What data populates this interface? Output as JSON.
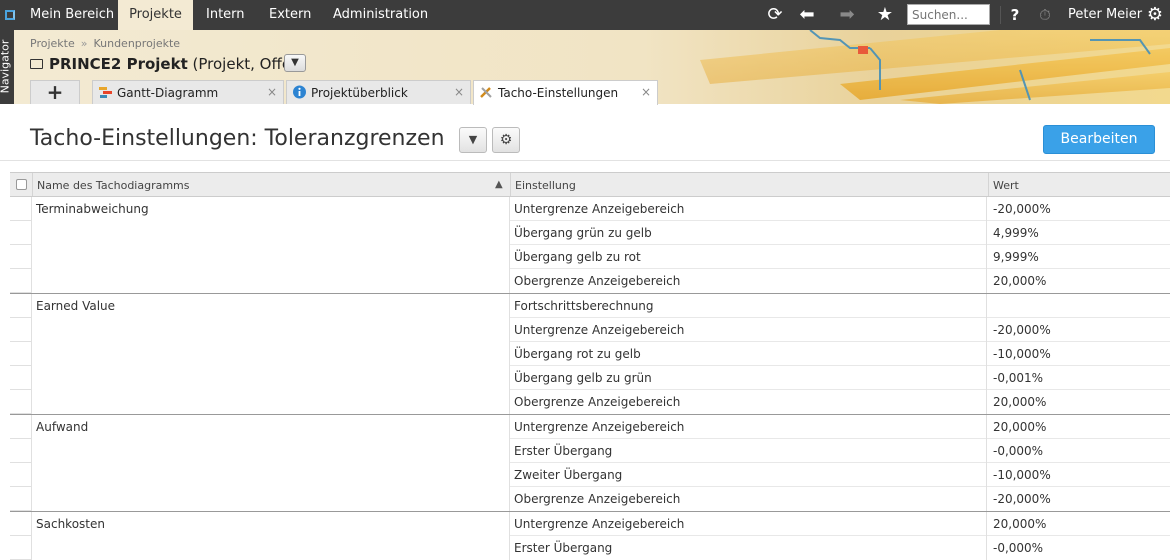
{
  "topnav": {
    "items": [
      "Mein Bereich",
      "Projekte",
      "Intern",
      "Extern",
      "Administration"
    ],
    "search_placeholder": "Suchen...",
    "help": "?",
    "user": "Peter Meier"
  },
  "navigator_label": "Navigator",
  "breadcrumb": {
    "first": "Projekte",
    "separator": "»",
    "second": "Kundenprojekte"
  },
  "project": {
    "name": "PRINCE2 Projekt",
    "meta": "(Projekt, Offen)"
  },
  "tabs": {
    "add": "+",
    "items": [
      {
        "label": "Gantt-Diagramm"
      },
      {
        "label": "Projektüberblick"
      },
      {
        "label": "Tacho-Einstellungen"
      }
    ],
    "close": "×"
  },
  "page": {
    "title": "Tacho-Einstellungen: Toleranzgrenzen",
    "edit_button": "Bearbeiten"
  },
  "table": {
    "columns": [
      "Name des Tachodiagramms",
      "Einstellung",
      "Wert"
    ],
    "groups": [
      {
        "name": "Terminabweichung",
        "rows": [
          {
            "setting": "Untergrenze Anzeigebereich",
            "value": "-20,000%"
          },
          {
            "setting": "Übergang grün zu gelb",
            "value": "4,999%"
          },
          {
            "setting": "Übergang gelb zu rot",
            "value": "9,999%"
          },
          {
            "setting": "Obergrenze Anzeigebereich",
            "value": "20,000%"
          }
        ]
      },
      {
        "name": "Earned Value",
        "rows": [
          {
            "setting": "Fortschrittsberechnung",
            "value": ""
          },
          {
            "setting": "Untergrenze Anzeigebereich",
            "value": "-20,000%"
          },
          {
            "setting": "Übergang rot zu gelb",
            "value": "-10,000%"
          },
          {
            "setting": "Übergang gelb zu grün",
            "value": "-0,001%"
          },
          {
            "setting": "Obergrenze Anzeigebereich",
            "value": "20,000%"
          }
        ]
      },
      {
        "name": "Aufwand",
        "rows": [
          {
            "setting": "Untergrenze Anzeigebereich",
            "value": "20,000%"
          },
          {
            "setting": "Erster Übergang",
            "value": "-0,000%"
          },
          {
            "setting": "Zweiter Übergang",
            "value": "-10,000%"
          },
          {
            "setting": "Obergrenze Anzeigebereich",
            "value": "-20,000%"
          }
        ]
      },
      {
        "name": "Sachkosten",
        "rows": [
          {
            "setting": "Untergrenze Anzeigebereich",
            "value": "20,000%"
          },
          {
            "setting": "Erster Übergang",
            "value": "-0,000%"
          }
        ]
      }
    ]
  }
}
